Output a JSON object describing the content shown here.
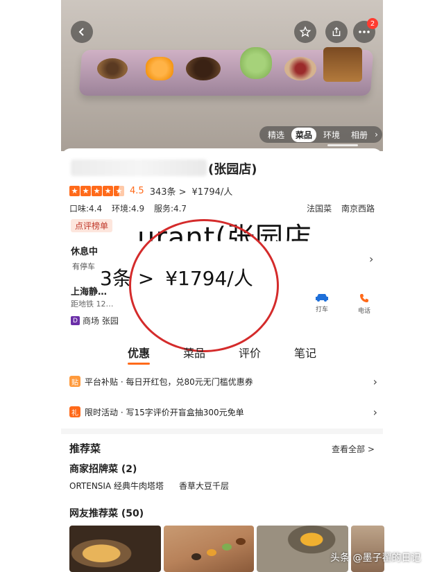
{
  "hero": {
    "tabs": [
      {
        "label": "精选",
        "active": false
      },
      {
        "label": "菜品",
        "active": true
      },
      {
        "label": "环境",
        "active": false
      },
      {
        "label": "相册",
        "active": false
      }
    ],
    "more_badge": "2",
    "icons": {
      "back": "chevron-left-icon",
      "favorite": "star-icon",
      "share": "share-icon",
      "more": "more-dots-icon"
    }
  },
  "shop": {
    "branch": "(张园店)",
    "score": "4.5",
    "reviews": "343条 >",
    "price": "¥1794/人",
    "taste": "口味:4.4",
    "env": "环境:4.9",
    "service": "服务:4.7",
    "cuisine": "法国菜",
    "area": "南京西路",
    "board_tag": "点评榜单",
    "zoom_title": "urant(张园店",
    "hours": "休息中",
    "hours_sub": "有停车",
    "zoom_reviews": "3条 >",
    "zoom_price": "¥1794/人",
    "address": "上海静…",
    "distance": "距地铁 12…",
    "mall": "商场 张园",
    "taxi_label": "打车",
    "phone_label": "电话"
  },
  "section_tabs": [
    {
      "label": "优惠",
      "active": true
    },
    {
      "label": "菜品",
      "active": false
    },
    {
      "label": "评价",
      "active": false
    },
    {
      "label": "笔记",
      "active": false
    }
  ],
  "promos": [
    {
      "icon_text": "贴",
      "text": "平台补贴 · 每日开红包，兑80元无门槛优惠券"
    },
    {
      "icon_text": "礼",
      "text": "限时活动 · 写15字评价开盲盒抽300元免单"
    }
  ],
  "recommend": {
    "title": "推荐菜",
    "view_all": "查看全部 >",
    "signature_title": "商家招牌菜 (2)",
    "dishes": [
      "ORTENSIA 经典牛肉塔塔",
      "香草大豆千层"
    ],
    "netizen_title": "网友推荐菜 (50)"
  },
  "watermark": "头条 @墨子翟的日记",
  "colors": {
    "accent": "#ff6a1a",
    "highlight_circle": "#d42b2b",
    "badge": "#ff3b30"
  }
}
